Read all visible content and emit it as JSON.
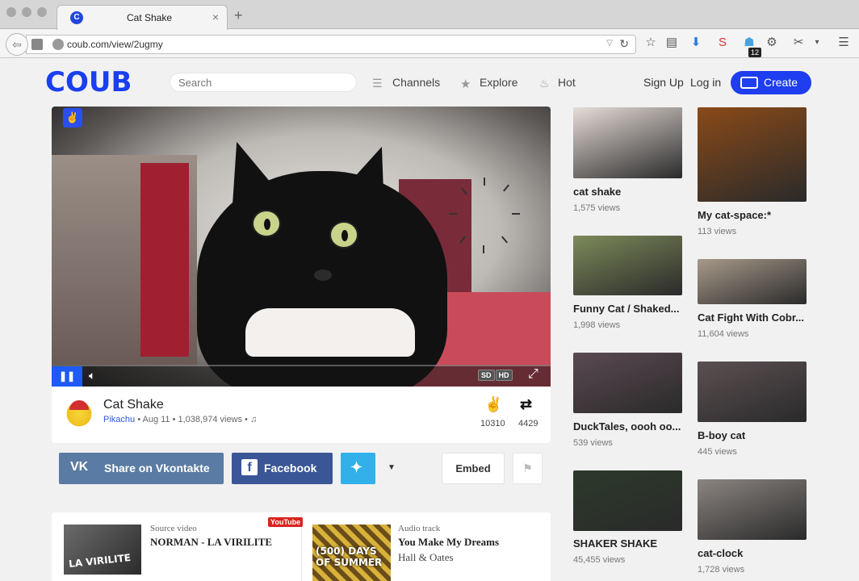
{
  "browser": {
    "tab_title": "Cat Shake",
    "tab_favicon": "C",
    "new_tab": "+",
    "tab_close": "×",
    "url": "coub.com/view/2ugmy",
    "ext_badge": "12"
  },
  "header": {
    "logo": "COUB",
    "search_placeholder": "Search",
    "nav": [
      "Channels",
      "Explore",
      "Hot"
    ],
    "signup": "Sign Up",
    "login": "Log in",
    "create": "Create"
  },
  "video": {
    "quality": [
      "SD",
      "HD"
    ],
    "title": "Cat Shake",
    "author": "Pikachu",
    "meta": " • Aug 11 • 1,038,974 views • ♫",
    "likes": "10310",
    "recoubs": "4429"
  },
  "share": {
    "vk": "Share on Vkontakte",
    "fb": "Facebook",
    "embed": "Embed"
  },
  "sources": {
    "video_label": "Source video",
    "video_title": "NORMAN - LA VIRILITE",
    "video_thumb_text": "LA VIRILITE",
    "youtube": "YouTube",
    "audio_label": "Audio track",
    "audio_title": "You Make My Dreams",
    "audio_artist": "Hall & Oates",
    "audio_thumb_text": "(500) DAYS OF SUMMER"
  },
  "related": [
    {
      "title": "cat shake",
      "views": "1,575 views",
      "color": "#e6ddd8"
    },
    {
      "title": "My cat-space:*",
      "views": "113 views",
      "color": "#8a4a18"
    },
    {
      "title": "Funny Cat / Shaked...",
      "views": "1,998 views",
      "color": "#7d8a5a"
    },
    {
      "title": "Cat Fight With Cobr...",
      "views": "11,604 views",
      "color": "#a89a8a"
    },
    {
      "title": "DuckTales, oooh oo...",
      "views": "539 views",
      "color": "#5a4a52"
    },
    {
      "title": "B-boy cat",
      "views": "445 views",
      "color": "#5b5052"
    },
    {
      "title": "SHAKER SHAKE",
      "views": "45,455 views",
      "color": "#2c3a2a"
    },
    {
      "title": "cat-clock",
      "views": "1,728 views",
      "color": "#8b8581"
    }
  ]
}
